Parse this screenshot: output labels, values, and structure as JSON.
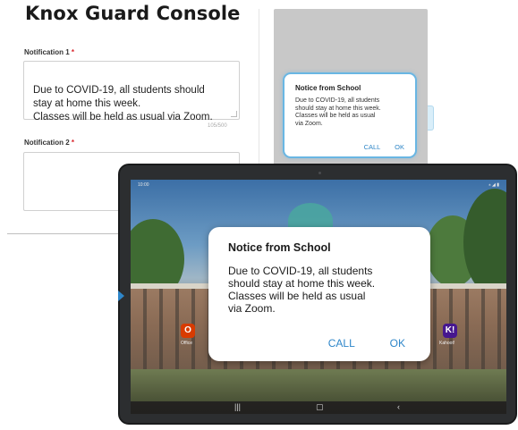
{
  "console": {
    "title": "Knox Guard Console",
    "notification1": {
      "label": "Notification 1",
      "required_mark": "*",
      "value": "Due to COVID-19, all students should\nstay at home this week.\nClasses will be held as usual via Zoom.",
      "counter": "105/500"
    },
    "notification2": {
      "label": "Notification 2",
      "required_mark": "*",
      "value": ""
    }
  },
  "preview": {
    "title": "Notice from School",
    "body": "Due to COVID-19, all students\nshould stay at home this week.\nClasses will be held as usual\nvia Zoom.",
    "call_label": "CALL",
    "ok_label": "OK"
  },
  "tablet": {
    "status_time": "10:00",
    "status_icons": "⁎ ◢ ▮",
    "dialog": {
      "title": "Notice from School",
      "body": "Due to COVID-19, all students\nshould stay at home this week.\nClasses will be held as usual\nvia Zoom.",
      "call_label": "CALL",
      "ok_label": "OK"
    },
    "apps": [
      {
        "label": "Office",
        "glyph": "O",
        "color": "#d83b01"
      },
      {
        "label": "Kahoot!",
        "glyph": "K!",
        "color": "#46178f"
      }
    ],
    "page_dots": "• •",
    "nav": {
      "recents": "|||",
      "home": "▢",
      "back": "‹"
    }
  }
}
